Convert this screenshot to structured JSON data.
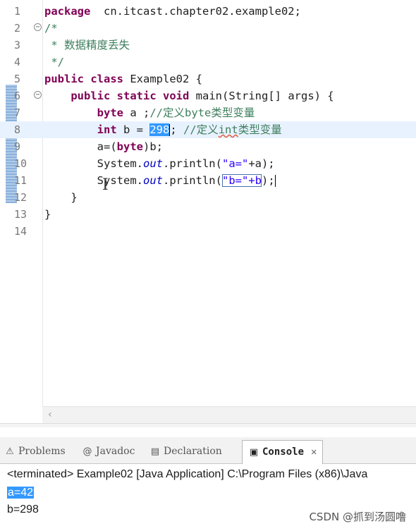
{
  "editor": {
    "lines": [
      {
        "n": "1",
        "parts": [
          [
            "kw",
            "package"
          ],
          [
            "",
            "  cn.itcast.chapter02.example02;"
          ]
        ]
      },
      {
        "n": "2",
        "fold": true,
        "parts": [
          [
            "cm",
            "/*"
          ]
        ]
      },
      {
        "n": "3",
        "parts": [
          [
            "cm",
            " * "
          ],
          [
            "cm cn",
            "数据精度丢失"
          ]
        ]
      },
      {
        "n": "4",
        "parts": [
          [
            "cm",
            " */"
          ]
        ]
      },
      {
        "n": "5",
        "parts": [
          [
            "kw",
            "public"
          ],
          [
            "",
            " "
          ],
          [
            "kw",
            "class"
          ],
          [
            "",
            " Example02 {"
          ]
        ]
      },
      {
        "n": "6",
        "fold": true,
        "parts": [
          [
            "",
            "    "
          ],
          [
            "kw",
            "public"
          ],
          [
            "",
            " "
          ],
          [
            "kw",
            "static"
          ],
          [
            "",
            " "
          ],
          [
            "kw",
            "void"
          ],
          [
            "",
            " main(String[] args) {"
          ]
        ]
      },
      {
        "n": "7",
        "parts": [
          [
            "",
            "        "
          ],
          [
            "kw",
            "byte"
          ],
          [
            "",
            " a ;"
          ],
          [
            "cm",
            "//"
          ],
          [
            "cm cn",
            "定义"
          ],
          [
            "cm",
            "byte"
          ],
          [
            "cm cn",
            "类型变量"
          ]
        ]
      },
      {
        "n": "8",
        "current": true,
        "parts": [
          [
            "",
            "        "
          ],
          [
            "kw",
            "int"
          ],
          [
            "",
            " b = "
          ],
          [
            "sel",
            "298"
          ],
          [
            "caret",
            ""
          ],
          [
            "",
            ";"
          ],
          [
            "",
            " "
          ],
          [
            "cm",
            "//"
          ],
          [
            "cm cn",
            "定义"
          ],
          [
            "cm squig",
            "int"
          ],
          [
            "cm cn",
            "类型变量"
          ]
        ]
      },
      {
        "n": "9",
        "parts": [
          [
            "",
            "        a=("
          ],
          [
            "kw",
            "byte"
          ],
          [
            "",
            ")b;"
          ]
        ]
      },
      {
        "n": "10",
        "parts": [
          [
            "",
            "        System."
          ],
          [
            "it",
            "out"
          ],
          [
            "",
            ".println("
          ],
          [
            "st",
            "\"a=\""
          ],
          [
            "",
            "+a);"
          ]
        ]
      },
      {
        "n": "11",
        "parts": [
          [
            "",
            "        System."
          ],
          [
            "it",
            "out"
          ],
          [
            "",
            ".println("
          ],
          [
            "st box",
            "\"b=\"+b"
          ],
          [
            "",
            ");"
          ],
          [
            "caret",
            ""
          ]
        ]
      },
      {
        "n": "12",
        "parts": [
          [
            "",
            "    }"
          ]
        ]
      },
      {
        "n": "13",
        "parts": [
          [
            "",
            "}"
          ]
        ]
      },
      {
        "n": "14",
        "parts": []
      }
    ]
  },
  "panel": {
    "tabs": [
      {
        "label": "Problems",
        "icon": "⚠",
        "icon_name": "problems-icon",
        "active": false
      },
      {
        "label": "Javadoc",
        "icon": "@",
        "icon_name": "javadoc-icon",
        "active": false
      },
      {
        "label": "Declaration",
        "icon": "▤",
        "icon_name": "declaration-icon",
        "active": false
      },
      {
        "label": "Console",
        "icon": "▣",
        "icon_name": "console-icon",
        "active": true,
        "close": "✕"
      }
    ],
    "terminated": "<terminated> Example02 [Java Application] C:\\Program Files (x86)\\Java",
    "output": [
      "a=42",
      "b=298"
    ]
  },
  "watermark": "CSDN @抓到汤圆噜",
  "colors": {
    "keyword": "#7f0055",
    "comment": "#3f7f5f",
    "string": "#2a00ff",
    "selection": "#3399ff",
    "current_line": "#e8f2fe"
  }
}
